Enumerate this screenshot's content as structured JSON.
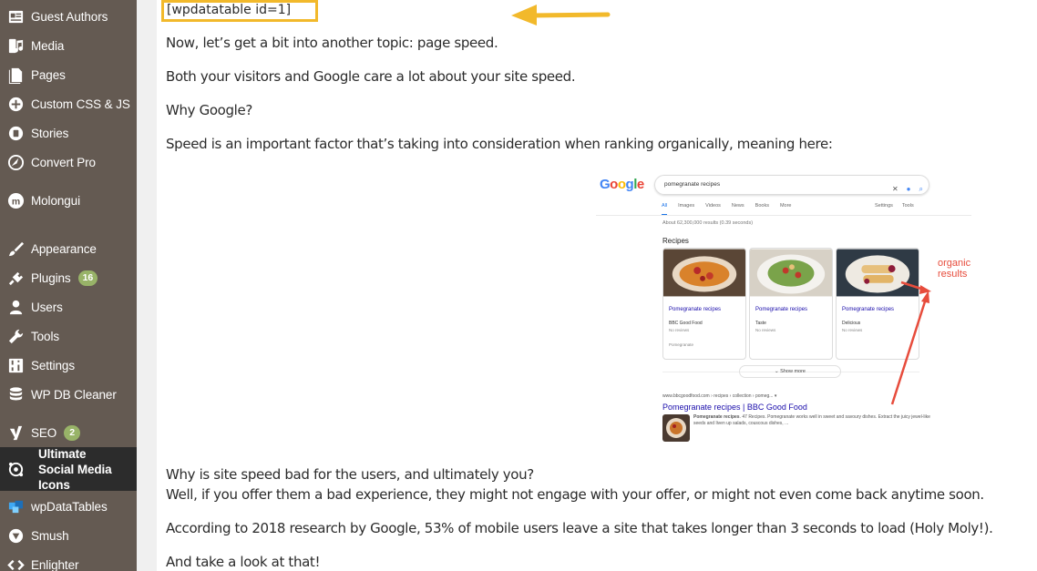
{
  "sidebar": {
    "items": [
      {
        "label": "Guest Authors",
        "icon": "guest-authors-icon"
      },
      {
        "label": "Media",
        "icon": "media-icon"
      },
      {
        "label": "Pages",
        "icon": "pages-icon"
      },
      {
        "label": "Custom CSS & JS",
        "icon": "plus-circle-icon"
      },
      {
        "label": "Stories",
        "icon": "stories-icon"
      },
      {
        "label": "Convert Pro",
        "icon": "compass-icon"
      },
      {
        "label": "Molongui",
        "icon": "molongui-icon"
      },
      {
        "label": "Appearance",
        "icon": "paintbrush-icon"
      },
      {
        "label": "Plugins",
        "icon": "plug-icon",
        "badge": "16"
      },
      {
        "label": "Users",
        "icon": "users-icon"
      },
      {
        "label": "Tools",
        "icon": "wrench-icon"
      },
      {
        "label": "Settings",
        "icon": "settings-icon"
      },
      {
        "label": "WP DB Cleaner",
        "icon": "database-icon"
      },
      {
        "label": "SEO",
        "icon": "yoast-icon",
        "badge": "2"
      },
      {
        "label": "Ultimate Social Media Icons",
        "icon": "social-icon",
        "active": true
      },
      {
        "label": "wpDataTables",
        "icon": "wpdatatables-icon"
      },
      {
        "label": "Smush",
        "icon": "smush-icon"
      },
      {
        "label": "Enlighter",
        "icon": "code-icon"
      }
    ]
  },
  "content": {
    "shortcode": "[wpdatatable id=1]",
    "paragraphs": {
      "p1": "Now, let’s get a bit into another topic: page speed.",
      "p2": "Both your visitors and Google care a lot about your site speed.",
      "p3": "Why Google?",
      "p4": "Speed is an important factor that’s taking into consideration when ranking organically, meaning here:",
      "p5": "Why is site speed bad for the users, and ultimately you?",
      "p6": "Well, if you offer them a bad experience, they might not engage with your offer, or might not even come back anytime soon.",
      "p7": "According to 2018 research by Google, 53% of mobile users leave a site that takes longer than 3 seconds to load (Holy Moly!).",
      "p8": "And take a look at that!"
    }
  },
  "google_screenshot": {
    "logo": "Google",
    "query": "pomegranate recipes",
    "tabs": [
      "All",
      "Images",
      "Videos",
      "News",
      "Books",
      "More"
    ],
    "tools": [
      "Settings",
      "Tools"
    ],
    "stats": "About 62,300,000 results (0.39 seconds)",
    "recipes_title": "Recipes",
    "cards": [
      {
        "title": "Pomegranate recipes",
        "source": "BBC Good Food",
        "reviews": "No reviews",
        "extra": "Pomegranate"
      },
      {
        "title": "Pomegranate recipes",
        "source": "Taste",
        "reviews": "No reviews",
        "extra": ""
      },
      {
        "title": "Pomegranate recipes",
        "source": "Delicious",
        "reviews": "No reviews",
        "extra": ""
      }
    ],
    "show_more": "Show more",
    "cite": "www.bbcgoodfood.com › recipes › collection › pomeg... ▾",
    "result_title": "Pomegranate recipes | BBC Good Food",
    "snippet_bold": "Pomegranate recipes",
    "snippet": ". 47 Recipes. Pomegranate works well in sweet and savoury dishes. Extract the juicy jewel-like seeds and liven up salads, couscous dishes, ...",
    "annotation": "organic results"
  },
  "colors": {
    "sidebar_bg": "#645a52",
    "sidebar_active": "#2c2c2c",
    "badge": "#98b368",
    "highlight_border": "#f2b92b",
    "arrow_yellow": "#f2b92b",
    "annotation_red": "#e74c3c",
    "link_blue": "#1a0dab"
  }
}
